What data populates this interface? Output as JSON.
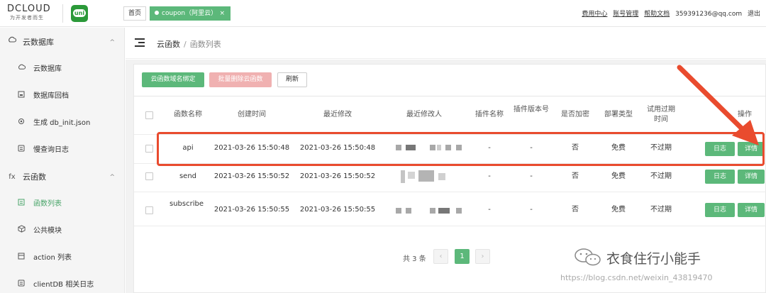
{
  "topbar": {
    "logo_text": "DCLOUD",
    "logo_subtitle": "为开发者而生",
    "app_icon_label": "uni",
    "tab_home": "首页",
    "tab_active": "coupon（阿里云）",
    "tab_close": "×",
    "links": [
      "费用中心",
      "账号管理",
      "帮助文档"
    ],
    "user_email": "359391236@qq.com",
    "logout": "退出"
  },
  "sidebar": {
    "groups": [
      {
        "label": "云数据库",
        "icon": "cloud-database-icon",
        "chevron": "^",
        "items": [
          {
            "label": "云数据库",
            "icon": "database-icon"
          },
          {
            "label": "数据库回档",
            "icon": "restore-icon"
          },
          {
            "label": "生成 db_init.json",
            "icon": "generate-icon"
          },
          {
            "label": "慢查询日志",
            "icon": "log-icon"
          }
        ]
      },
      {
        "label": "云函数",
        "icon_text": "fx",
        "chevron": "^",
        "items": [
          {
            "label": "函数列表",
            "icon": "list-icon",
            "active": true
          },
          {
            "label": "公共模块",
            "icon": "cube-icon"
          },
          {
            "label": "action 列表",
            "icon": "action-icon"
          },
          {
            "label": "clientDB 相关日志",
            "icon": "log-icon"
          }
        ]
      }
    ]
  },
  "breadcrumb": {
    "parent": "云函数",
    "separator": "/",
    "current": "函数列表"
  },
  "toolbar": {
    "bind_domain": "云函数域名绑定",
    "batch_delete": "批量删除云函数",
    "refresh": "刷新"
  },
  "table": {
    "headers": [
      "函数名称",
      "创建时间",
      "最近修改",
      "最近修改人",
      "插件名称",
      "插件版本号",
      "是否加密",
      "部署类型",
      "试用过期时间",
      "操作"
    ],
    "rows": [
      {
        "name": "api",
        "created": "2021-03-26 15:50:48",
        "modified": "2021-03-26 15:50:48",
        "plugin": "-",
        "plugin_version": "-",
        "encrypted": "否",
        "deploy": "免费",
        "trial": "不过期",
        "log_btn": "日志",
        "detail_btn": "详情"
      },
      {
        "name": "send",
        "created": "2021-03-26 15:50:52",
        "modified": "2021-03-26 15:50:52",
        "plugin": "-",
        "plugin_version": "-",
        "encrypted": "否",
        "deploy": "免费",
        "trial": "不过期",
        "log_btn": "日志",
        "detail_btn": "详情"
      },
      {
        "name": "subscribe",
        "created": "2021-03-26 15:50:55",
        "modified": "2021-03-26 15:50:55",
        "plugin": "-",
        "plugin_version": "-",
        "encrypted": "否",
        "deploy": "免费",
        "trial": "不过期",
        "log_btn": "日志",
        "detail_btn": "详情"
      }
    ]
  },
  "pagination": {
    "total": "共 3 条",
    "prev": "‹",
    "current": "1",
    "next": "›"
  },
  "watermark": {
    "text": "衣食住行小能手",
    "url": "https://blog.csdn.net/weixin_43819470"
  },
  "colors": {
    "accent": "#5cb87a",
    "danger_light": "#f0b1b1",
    "annotation": "#e94b2e"
  }
}
